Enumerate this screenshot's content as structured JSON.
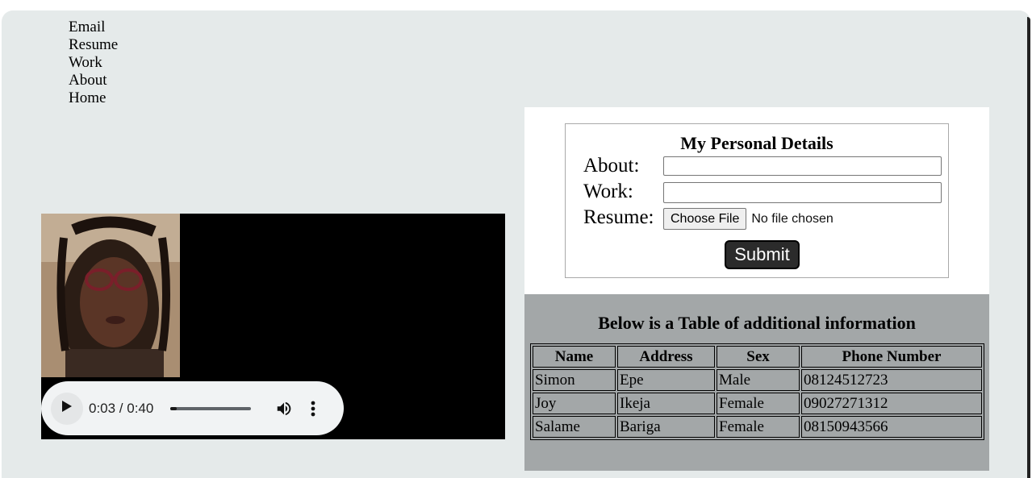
{
  "nav": {
    "items": [
      "Email",
      "Resume",
      "Work",
      "About",
      "Home"
    ]
  },
  "media": {
    "portrait_alt": "portrait photo",
    "audio": {
      "current_time": "0:03",
      "duration": "0:40",
      "time_display": "0:03 / 0:40",
      "progress_fraction": 0.075
    }
  },
  "form": {
    "legend": "My Personal Details",
    "about_label": "About:",
    "work_label": "Work:",
    "resume_label": "Resume:",
    "file_button": "Choose File",
    "file_status": "No file chosen",
    "submit_label": "Submit"
  },
  "table": {
    "title": "Below is a Table of additional information",
    "headers": [
      "Name",
      "Address",
      "Sex",
      "Phone Number"
    ],
    "rows": [
      [
        "Simon",
        "Epe",
        "Male",
        "08124512723"
      ],
      [
        "Joy",
        "Ikeja",
        "Female",
        "09027271312"
      ],
      [
        "Salame",
        "Bariga",
        "Female",
        "08150943566"
      ]
    ]
  },
  "colors": {
    "page_background": "#e5eaea",
    "table_panel": "#a3a7a8",
    "submit_button": "#2b2b2b"
  }
}
